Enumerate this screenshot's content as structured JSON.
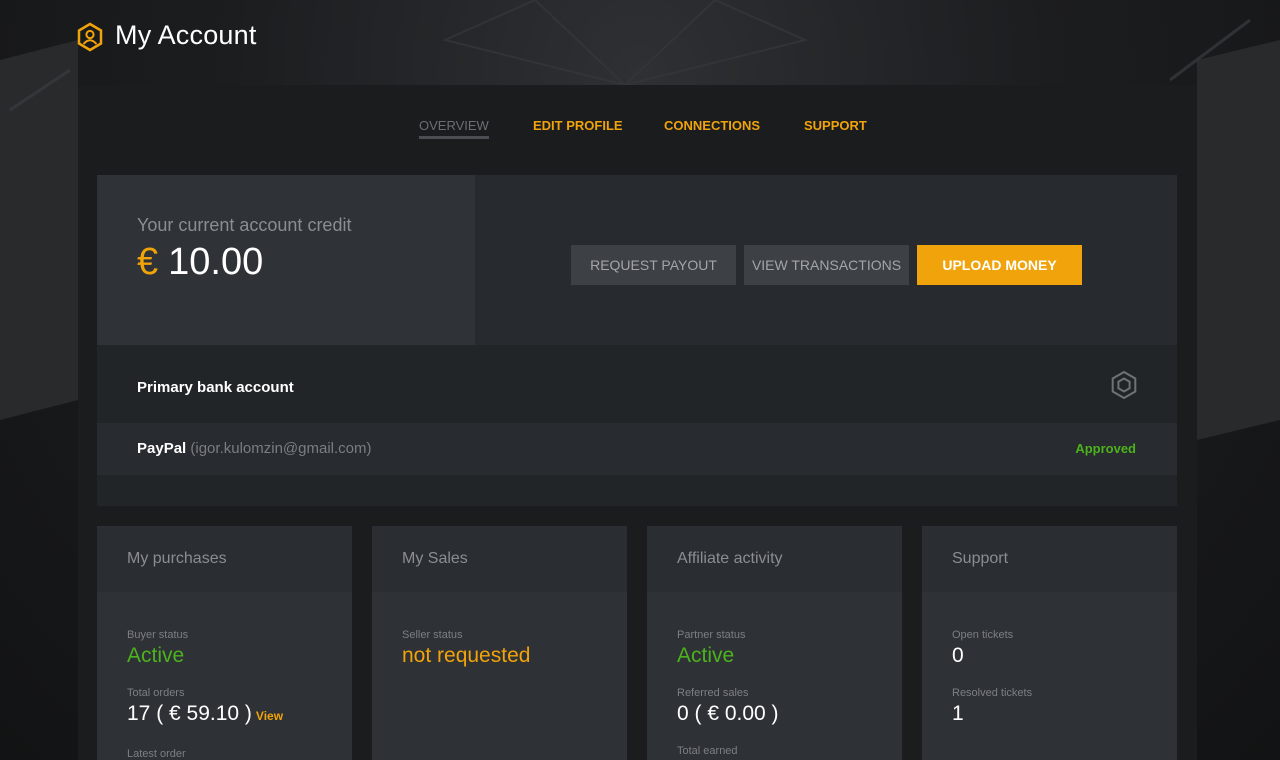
{
  "header": {
    "title": "My Account",
    "logo_icon": "user-hexagon-icon"
  },
  "tabs": [
    {
      "label": "OVERVIEW",
      "active": true
    },
    {
      "label": "EDIT PROFILE",
      "active": false
    },
    {
      "label": "CONNECTIONS",
      "active": false
    },
    {
      "label": "SUPPORT",
      "active": false
    }
  ],
  "credit": {
    "label": "Your current account credit",
    "currency": "€",
    "amount": "10.00"
  },
  "actions": {
    "request_payout": "REQUEST PAYOUT",
    "view_transactions": "VIEW TRANSACTIONS",
    "upload_money": "UPLOAD MONEY"
  },
  "bank": {
    "title": "Primary bank account",
    "settings_icon": "gear-icon",
    "method": "PayPal",
    "email": "(igor.kulomzin@gmail.com)",
    "status": "Approved"
  },
  "cards": {
    "purchases": {
      "title": "My purchases",
      "buyer_status_label": "Buyer status",
      "buyer_status": "Active",
      "total_orders_label": "Total orders",
      "total_orders": "17 ( € 59.10 )",
      "view_link": "View",
      "latest_order_label": "Latest order"
    },
    "sales": {
      "title": "My Sales",
      "seller_status_label": "Seller status",
      "seller_status": "not requested"
    },
    "affiliate": {
      "title": "Affiliate activity",
      "partner_status_label": "Partner status",
      "partner_status": "Active",
      "referred_sales_label": "Referred sales",
      "referred_sales": "0 ( € 0.00 )",
      "total_earned_label": "Total earned"
    },
    "support": {
      "title": "Support",
      "open_tickets_label": "Open tickets",
      "open_tickets": "0",
      "resolved_tickets_label": "Resolved tickets",
      "resolved_tickets": "1"
    }
  },
  "colors": {
    "accent": "#f0a30a",
    "success": "#4cb21d",
    "panel": "#1a1c1e"
  }
}
